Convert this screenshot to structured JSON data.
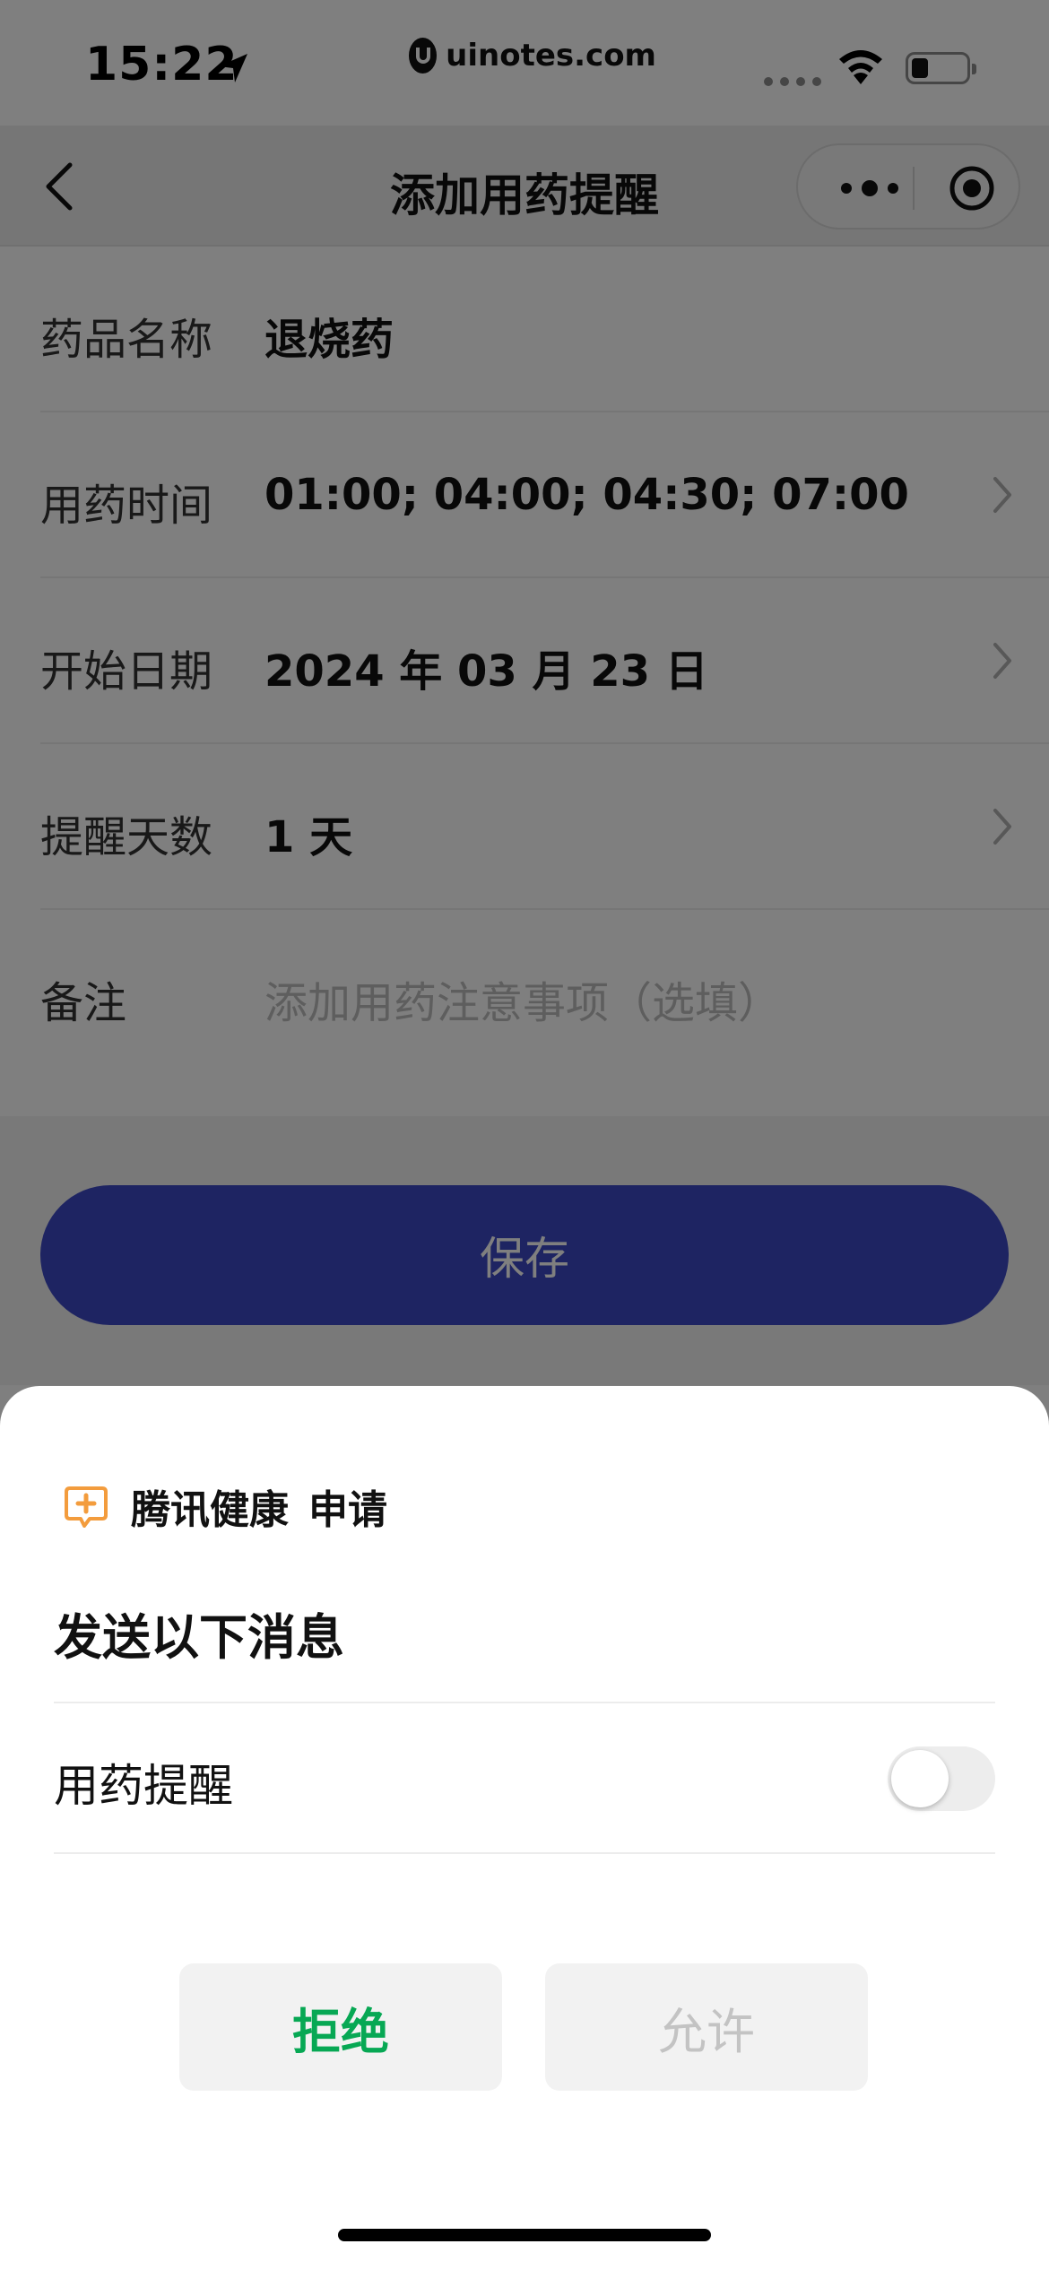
{
  "status_bar": {
    "time": "15:22",
    "watermark": "uinotes.com",
    "icons": [
      "location-arrow-icon",
      "signal-dots-icon",
      "wifi-icon",
      "battery-icon"
    ]
  },
  "navbar": {
    "title": "添加用药提醒",
    "icons": [
      "back-arrow-icon",
      "more-dots-icon",
      "target-circle-icon"
    ]
  },
  "form": {
    "rows": [
      {
        "label": "药品名称",
        "value": "退烧药"
      },
      {
        "label": "用药时间",
        "value": "01:00; 04:00; 04:30; 07:00"
      },
      {
        "label": "开始日期",
        "value": "2024 年 03 月 23 日"
      },
      {
        "label": "提醒天数",
        "value": "1 天"
      },
      {
        "label": "备注",
        "placeholder": "添加用药注意事项（选填）"
      }
    ],
    "save_label": "保存"
  },
  "sheet": {
    "app_name": "腾讯健康",
    "apply_label": "申请",
    "title": "发送以下消息",
    "message_label": "用药提醒",
    "toggle_on": false,
    "reject_label": "拒绝",
    "allow_label": "允许"
  },
  "colors": {
    "primary_button": "#3c48c4",
    "reject_text": "#07a854",
    "app_icon": "#f39c3d",
    "overlay": "rgba(0,0,0,0.5)"
  }
}
